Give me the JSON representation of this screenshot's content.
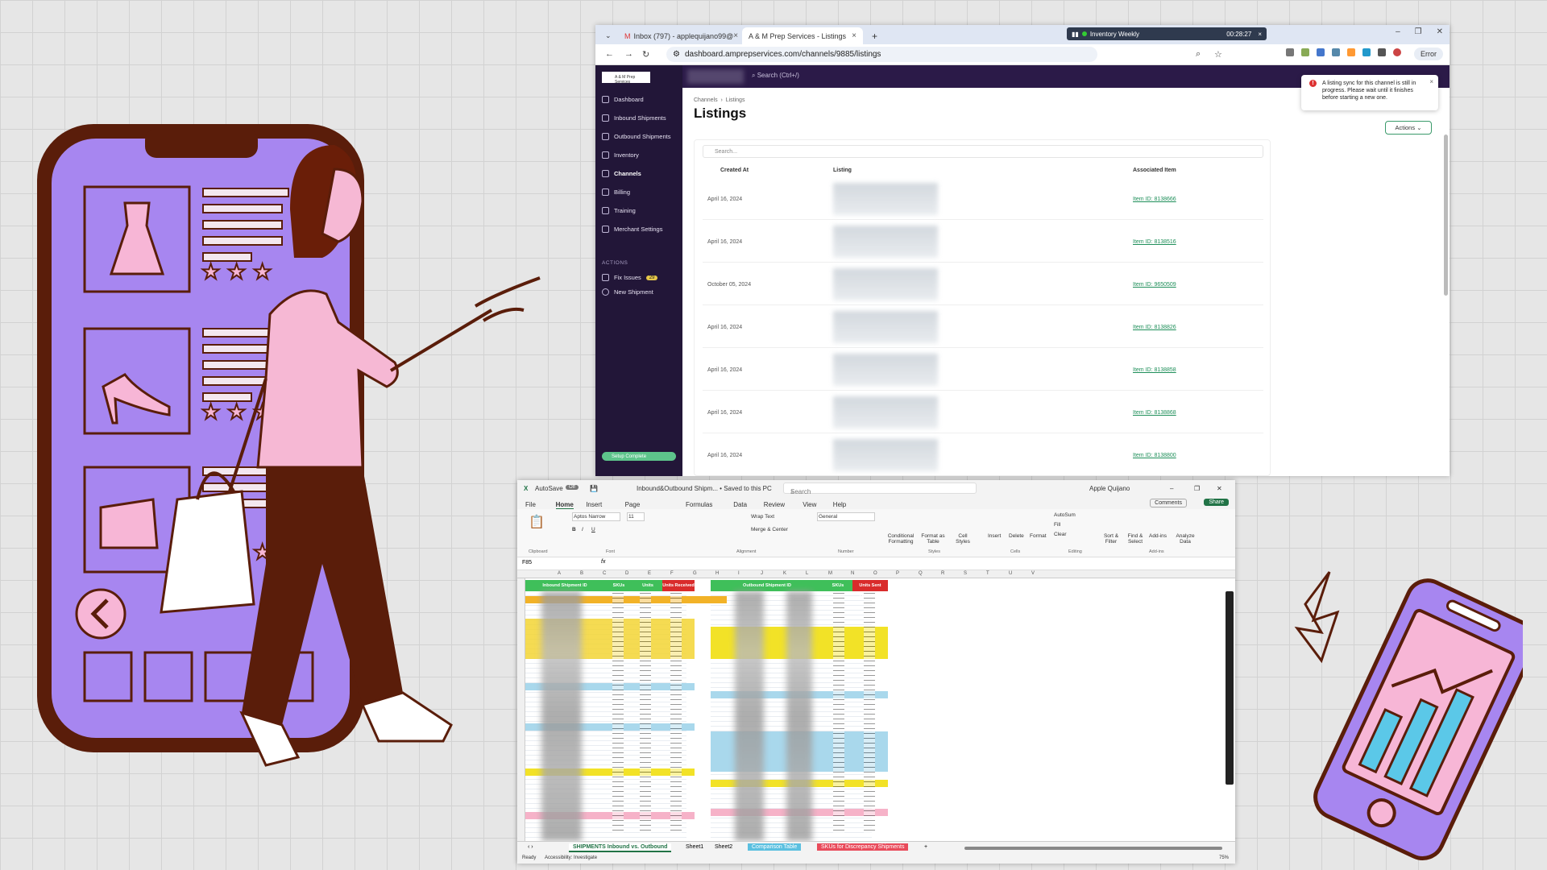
{
  "colors": {
    "accent": "#217346",
    "sidebar": "#221638",
    "phone_purple": "#a786f0",
    "phone_frame": "#5a1d0a",
    "shirt": "#f6b8d4"
  },
  "browser": {
    "tabs": [
      {
        "label": "Inbox (797) - applequijano99@",
        "active": false
      },
      {
        "label": "A & M Prep Services - Listings",
        "active": true
      }
    ],
    "recording": {
      "title": "Inventory Weekly",
      "time": "00:28:27"
    },
    "url": "dashboard.amprepservices.com/channels/9885/listings",
    "error_label": "Error",
    "app": {
      "logo_text": "A & M Prep Services",
      "search_placeholder": "Search (Ctrl+/)",
      "nav": [
        {
          "label": "Dashboard",
          "icon": "home-icon"
        },
        {
          "label": "Inbound Shipments",
          "icon": "inbound-icon"
        },
        {
          "label": "Outbound Shipments",
          "icon": "outbound-icon"
        },
        {
          "label": "Inventory",
          "icon": "inventory-icon"
        },
        {
          "label": "Channels",
          "icon": "channels-icon"
        },
        {
          "label": "Billing",
          "icon": "billing-icon"
        },
        {
          "label": "Training",
          "icon": "training-icon"
        },
        {
          "label": "Merchant Settings",
          "icon": "settings-icon"
        }
      ],
      "actions_label": "ACTIONS",
      "action_items": [
        {
          "label": "Fix Issues",
          "badge": "29"
        },
        {
          "label": "New Shipment"
        }
      ],
      "setup_label": "Setup Complete",
      "breadcrumb": [
        "Channels",
        "Listings"
      ],
      "title": "Listings",
      "toast": "A listing sync for this channel is still in progress. Please wait until it finishes before starting a new one.",
      "actions_button": "Actions",
      "table_search": "Search...",
      "columns": [
        "Created At",
        "Listing",
        "Associated Item"
      ],
      "rows": [
        {
          "date": "April 16, 2024",
          "item": "Item ID: 8138666"
        },
        {
          "date": "April 16, 2024",
          "item": "Item ID: 8138516"
        },
        {
          "date": "October 05, 2024",
          "item": "Item ID: 9650509"
        },
        {
          "date": "April 16, 2024",
          "item": "Item ID: 8138826"
        },
        {
          "date": "April 16, 2024",
          "item": "Item ID: 8138858"
        },
        {
          "date": "April 16, 2024",
          "item": "Item ID: 8138868"
        },
        {
          "date": "April 16, 2024",
          "item": "Item ID: 8138800"
        }
      ]
    }
  },
  "excel": {
    "autosave": "AutoSave",
    "autosave_state": "Off",
    "filename": "Inbound&Outbound Shipm...  •  Saved to this PC",
    "search": "Search",
    "user": "Apple Quijano",
    "menu": [
      "File",
      "Home",
      "Insert",
      "Page Layout",
      "Formulas",
      "Data",
      "Review",
      "View",
      "Help"
    ],
    "comments": "Comments",
    "share": "Share",
    "font": "Aptos Narrow",
    "font_size": "11",
    "ribbon": {
      "wrap": "Wrap Text",
      "merge": "Merge & Center",
      "number_format": "General",
      "cond": "Conditional Formatting",
      "format_table": "Format as Table",
      "cell_styles": "Cell Styles",
      "insert": "Insert",
      "delete": "Delete",
      "format": "Format",
      "autosum": "AutoSum",
      "fill": "Fill",
      "clear": "Clear",
      "sort": "Sort & Filter",
      "find": "Find & Select",
      "addins": "Add-ins",
      "analyze": "Analyze Data"
    },
    "groups": [
      "Clipboard",
      "Font",
      "Alignment",
      "Number",
      "Styles",
      "Cells",
      "Editing",
      "Add-ins"
    ],
    "cell_ref": "F85",
    "col_letters": [
      "A",
      "B",
      "C",
      "D",
      "E",
      "F",
      "G",
      "H",
      "I",
      "J",
      "K",
      "L",
      "M",
      "N",
      "O",
      "P",
      "Q",
      "R",
      "S",
      "T",
      "U",
      "V"
    ],
    "headers_left": [
      "Inbound Shipment ID",
      "SKUs",
      "Units",
      "Units Received"
    ],
    "headers_right": [
      "Outbound Shipment ID",
      "SKUs",
      "Units Sent Outbound"
    ],
    "sheet_tabs": [
      "SHIPMENTS Inbound vs. Outbound",
      "Sheet1",
      "Sheet2",
      "Comparison Table",
      "SKUs for Discrepancy Shipments"
    ],
    "status": "Ready",
    "accessibility": "Accessibility: Investigate",
    "zoom": "75%"
  }
}
